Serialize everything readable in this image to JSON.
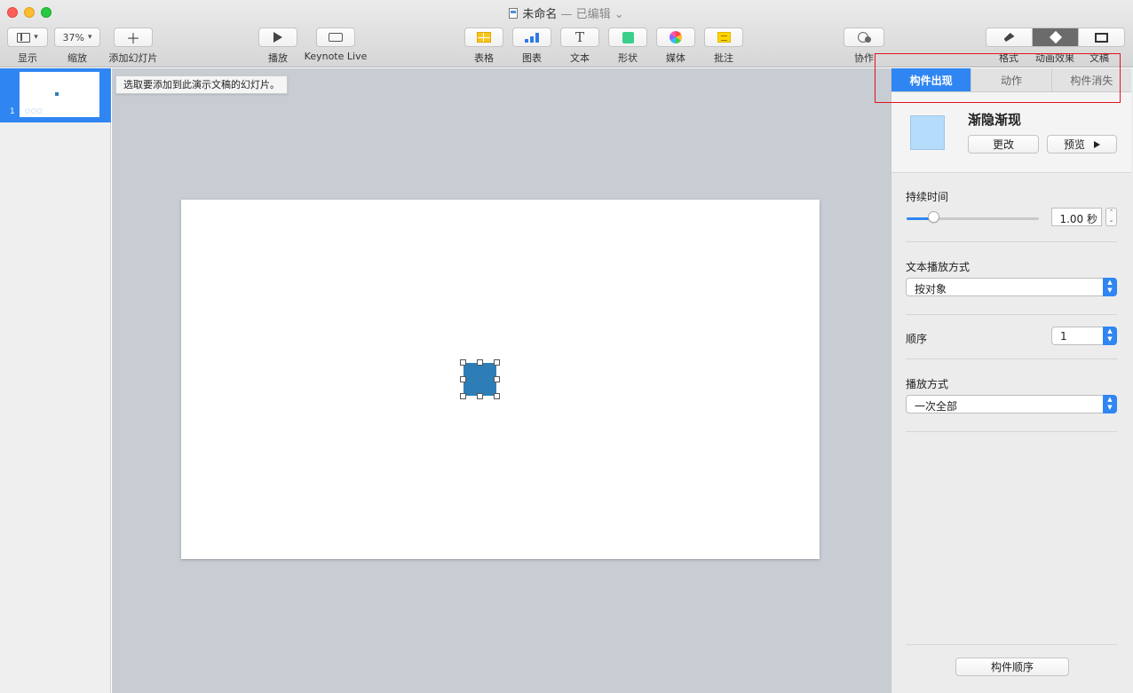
{
  "window": {
    "title": "未命名",
    "edited_label": "— 已编辑 ⌄"
  },
  "toolbar": {
    "view_label": "显示",
    "zoom_value": "37%",
    "zoom_label": "缩放",
    "add_slide_label": "添加幻灯片",
    "play_label": "播放",
    "keynote_live_label": "Keynote Live",
    "table_label": "表格",
    "chart_label": "图表",
    "text_label": "文本",
    "shape_label": "形状",
    "media_label": "媒体",
    "comment_label": "批注",
    "collaborate_label": "协作",
    "format_label": "格式",
    "animate_label": "动画效果",
    "document_label": "文稿"
  },
  "navigator": {
    "slides": [
      {
        "number": "1",
        "dots": "○○○"
      }
    ]
  },
  "canvas": {
    "tooltip": "选取要添加到此演示文稿的幻灯片。",
    "shape_color": "#2d7eb6"
  },
  "inspector": {
    "tabs": [
      {
        "label": "构件出现",
        "active": true
      },
      {
        "label": "动作",
        "active": false
      },
      {
        "label": "构件消失",
        "active": false
      }
    ],
    "effect": {
      "name": "渐隐渐现",
      "change_label": "更改",
      "preview_label": "预览"
    },
    "duration": {
      "label": "持续时间",
      "value": "1.00 秒",
      "slider_fraction": 0.2
    },
    "text_delivery": {
      "label": "文本播放方式",
      "value": "按对象"
    },
    "order": {
      "label": "顺序",
      "value": "1"
    },
    "delivery": {
      "label": "播放方式",
      "value": "一次全部"
    },
    "build_order_label": "构件顺序"
  },
  "colors": {
    "accent": "#2f86f2",
    "highlight_box": "#e0121d"
  }
}
